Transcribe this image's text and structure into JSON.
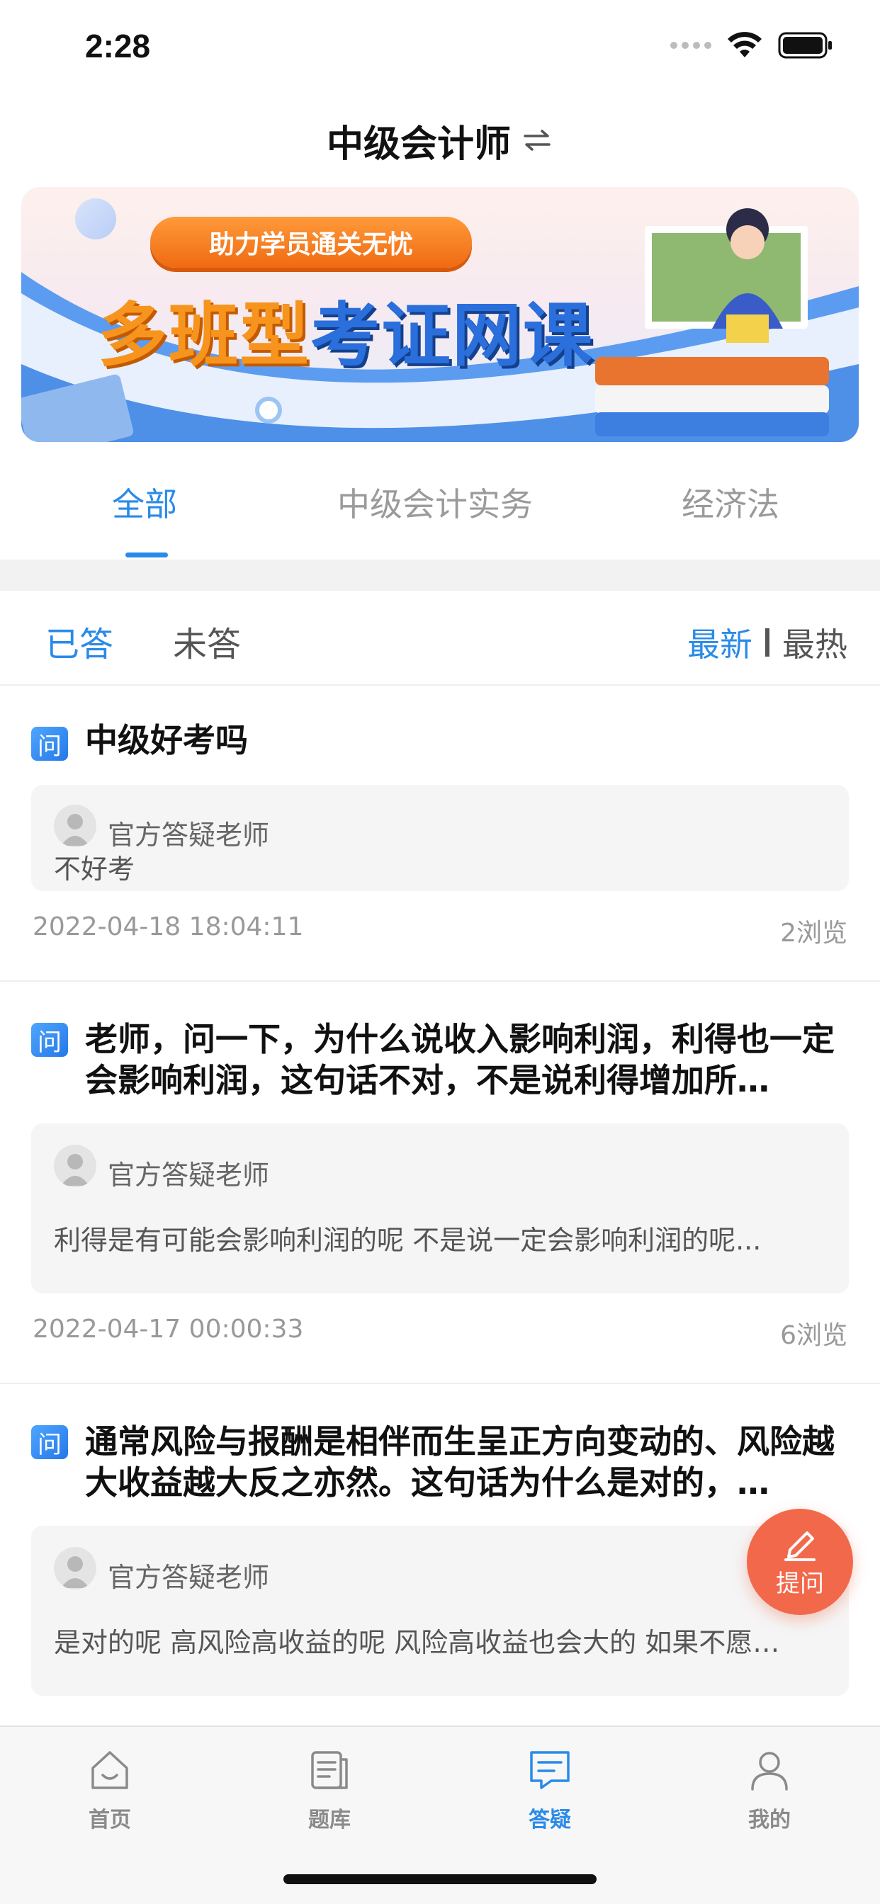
{
  "status_bar": {
    "time": "2:28"
  },
  "header": {
    "title": "中级会计师",
    "switch_icon": "swap-arrows-icon"
  },
  "banner": {
    "pill_text": "助力学员通关无忧",
    "headline_orange": "多班型",
    "headline_blue": "考证网课"
  },
  "subject_tabs": [
    {
      "label": "全部",
      "active": true
    },
    {
      "label": "中级会计实务",
      "active": false
    },
    {
      "label": "经济法",
      "active": false
    }
  ],
  "filter": {
    "tabs": [
      {
        "label": "已答",
        "active": true
      },
      {
        "label": "未答",
        "active": false
      }
    ],
    "sort_new": "最新",
    "sort_hot": "最热"
  },
  "questions": [
    {
      "badge": "问",
      "title": "中级好考吗",
      "teacher": "官方答疑老师",
      "answer": "不好考",
      "date": "2022-04-18 18:04:11",
      "views": "2浏览"
    },
    {
      "badge": "问",
      "title": "老师，问一下，为什么说收入影响利润，利得也一定会影响利润，这句话不对，不是说利得增加所…",
      "teacher": "官方答疑老师",
      "answer": "利得是有可能会影响利润的呢 不是说一定会影响利润的呢...",
      "date": "2022-04-17 00:00:33",
      "views": "6浏览"
    },
    {
      "badge": "问",
      "title": "通常风险与报酬是相伴而生呈正方向变动的、风险越大收益越大反之亦然。这句话为什么是对的，…",
      "teacher": "官方答疑老师",
      "answer": "是对的呢 高风险高收益的呢 风险高收益也会大的 如果不愿…"
    }
  ],
  "fab": {
    "label": "提问",
    "icon": "edit-pen-icon"
  },
  "tab_bar": [
    {
      "label": "首页",
      "icon": "home-icon",
      "active": false
    },
    {
      "label": "题库",
      "icon": "question-bank-icon",
      "active": false
    },
    {
      "label": "答疑",
      "icon": "qa-chat-icon",
      "active": true
    },
    {
      "label": "我的",
      "icon": "profile-icon",
      "active": false
    }
  ],
  "colors": {
    "accent": "#2a8ae8",
    "fab": "#f2684a",
    "banner_orange": "#f7941d",
    "banner_blue": "#2a6fdb"
  }
}
